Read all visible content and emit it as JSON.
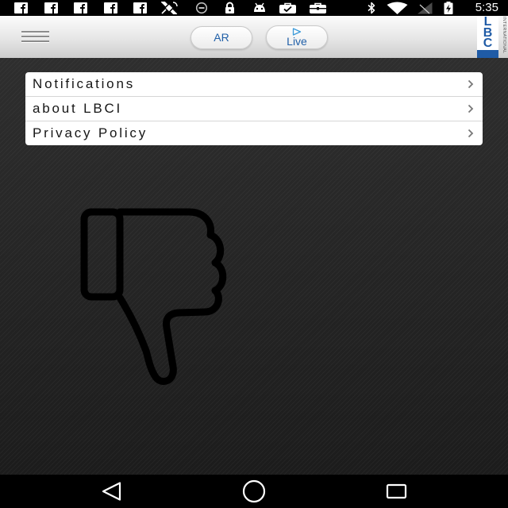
{
  "status_bar": {
    "notification_icons": [
      "facebook-icon",
      "facebook-icon",
      "facebook-icon",
      "facebook-icon",
      "facebook-icon",
      "satellite-icon",
      "do-not-disturb-icon",
      "lock-icon",
      "android-icon",
      "briefcase-check-icon",
      "briefcase-icon"
    ],
    "system_icons": [
      "bluetooth-icon",
      "wifi-icon",
      "no-signal-icon",
      "battery-charging-icon"
    ],
    "time": "5:35"
  },
  "header": {
    "menu_icon": "hamburger-icon",
    "ar_label": "AR",
    "live_icon": "play-icon",
    "live_label": "Live",
    "logo": {
      "letters": [
        "L",
        "B",
        "C"
      ],
      "tagline": "INTERNATIONAL"
    }
  },
  "menu": {
    "items": [
      {
        "label": "Notifications",
        "icon": "chevron-right-icon"
      },
      {
        "label": "about LBCI",
        "icon": "chevron-right-icon"
      },
      {
        "label": "Privacy Policy",
        "icon": "chevron-right-icon"
      }
    ]
  },
  "illustration": {
    "icon": "thumbs-down-icon"
  },
  "nav_bar": {
    "icons": [
      "back-icon",
      "home-icon",
      "recents-icon"
    ]
  },
  "colors": {
    "accent": "#2160a8",
    "logo_blue": "#1f5ba6",
    "play": "#3b9ad9",
    "card": "#ffffff",
    "text": "#161616",
    "chevron": "#777777",
    "background": "#242424"
  }
}
